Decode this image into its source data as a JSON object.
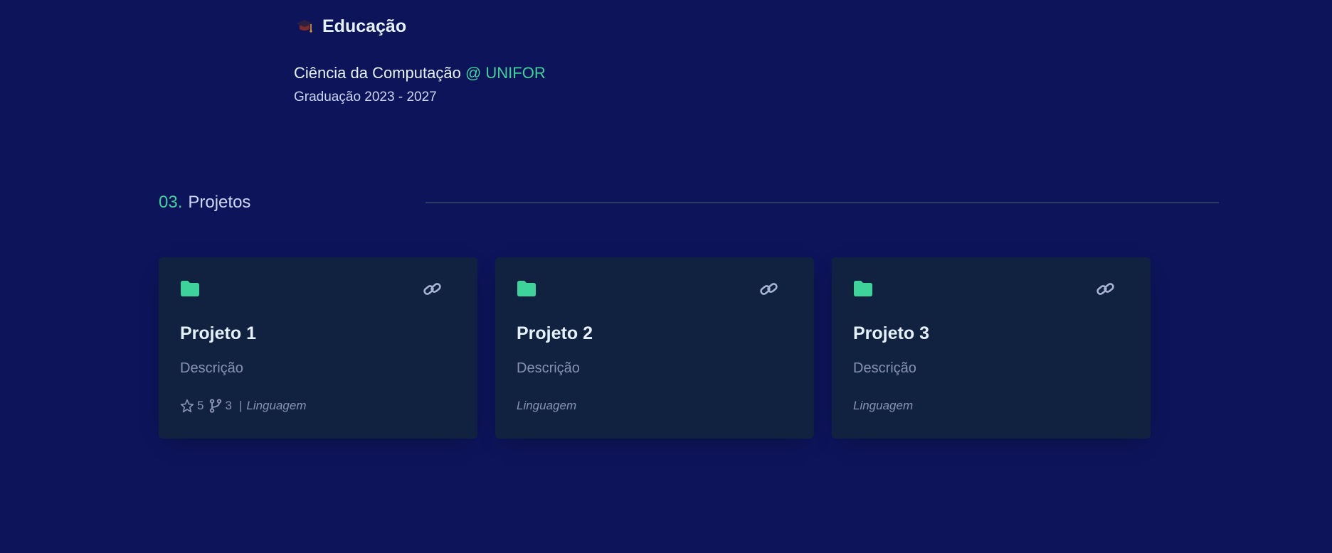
{
  "education": {
    "icon": "graduation-cap-icon",
    "title": "Educação",
    "degree": "Ciência da Computação",
    "school": "@ UNIFOR",
    "period": "Graduação 2023 - 2027"
  },
  "projects_section": {
    "number": "03.",
    "title": "Projetos"
  },
  "projects": [
    {
      "title": "Projeto 1",
      "description": "Descrição",
      "stars": "5",
      "forks": "3",
      "separator": "|",
      "language": "Linguagem"
    },
    {
      "title": "Projeto 2",
      "description": "Descrição",
      "language": "Linguagem"
    },
    {
      "title": "Projeto 3",
      "description": "Descrição",
      "language": "Linguagem"
    }
  ],
  "icons": {
    "folder": "folder-icon",
    "link": "link-icon",
    "star": "star-icon",
    "fork": "fork-icon"
  },
  "colors": {
    "background": "#0e145a",
    "card": "#112240",
    "accent": "#3dd39b",
    "text": "#e6f1ff",
    "muted": "#8892b0",
    "line": "#2c3a6a"
  }
}
